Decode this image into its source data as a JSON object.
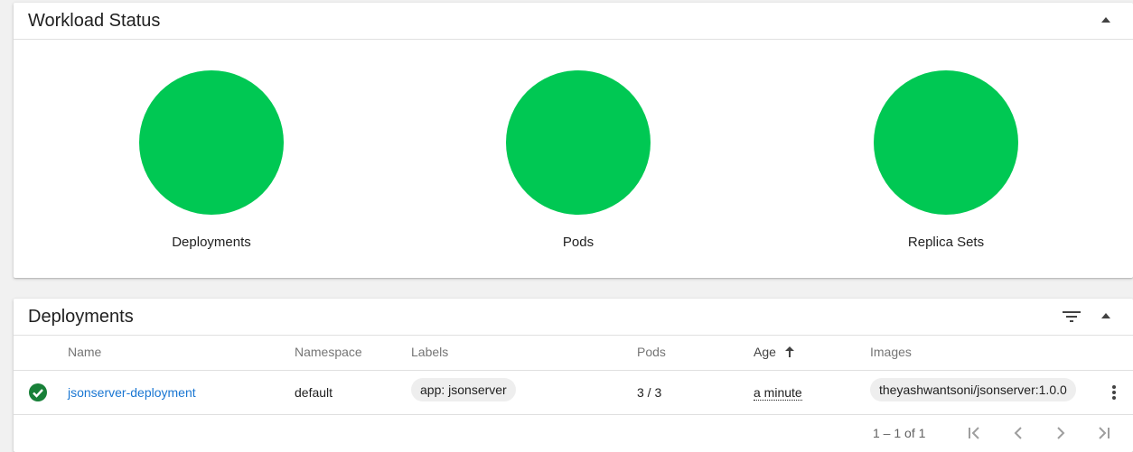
{
  "workload_status": {
    "title": "Workload Status",
    "collapse_icon": "arrow-drop-up-icon",
    "status_color": "#00c853",
    "charts": [
      {
        "label": "Deployments",
        "running_fraction": 1.0
      },
      {
        "label": "Pods",
        "running_fraction": 1.0
      },
      {
        "label": "Replica Sets",
        "running_fraction": 1.0
      }
    ]
  },
  "deployments": {
    "title": "Deployments",
    "filter_icon": "filter-list-icon",
    "collapse_icon": "arrow-drop-up-icon",
    "columns": {
      "name": "Name",
      "namespace": "Namespace",
      "labels": "Labels",
      "pods": "Pods",
      "age": "Age",
      "images": "Images"
    },
    "sort_icon": "arrow-upward-icon",
    "rows": [
      {
        "status_icon": "check-circle-icon",
        "status_color": "#188038",
        "name": "jsonserver-deployment",
        "namespace": "default",
        "label_chip": "app: jsonserver",
        "pods": "3 / 3",
        "age": "a minute",
        "image_chip": "theyashwantsoni/jsonserver:1.0.0",
        "menu_icon": "more-vert-icon"
      }
    ],
    "pagination": {
      "range_text": "1 – 1 of 1",
      "icons": [
        "first-page-icon",
        "chevron-left-icon",
        "chevron-right-icon",
        "last-page-icon"
      ]
    },
    "link_color": "#1976d2"
  }
}
